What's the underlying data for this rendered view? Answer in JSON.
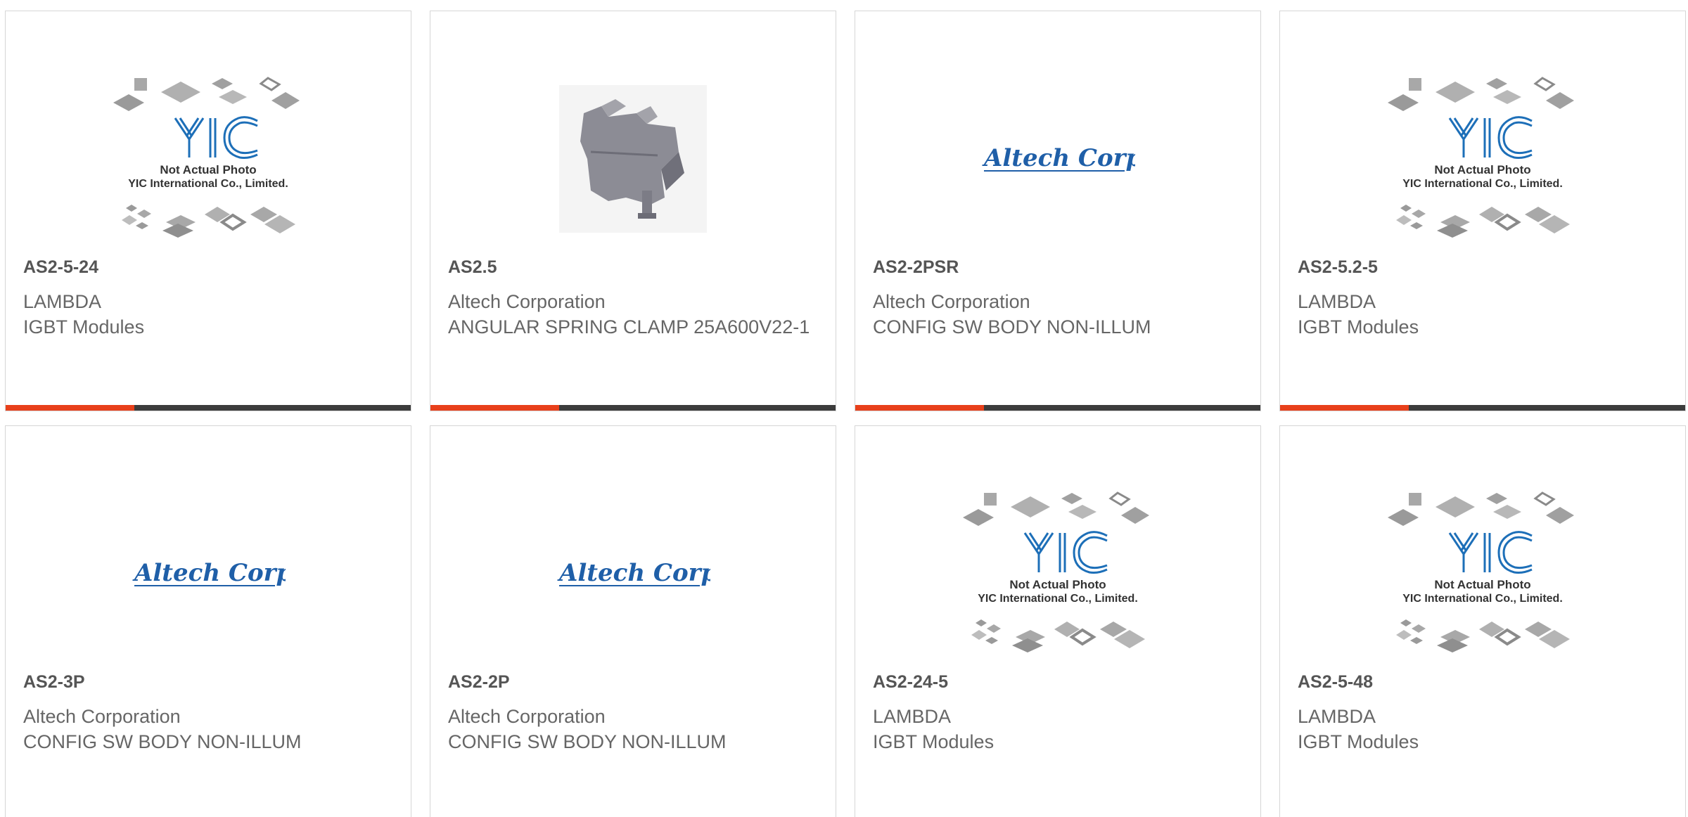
{
  "colors": {
    "accent": "#e8401b",
    "bar": "#3c3c3c",
    "altech_blue": "#1f5fa8",
    "yic_blue": "#1d6fb8"
  },
  "placeholder": {
    "yic_line1": "Not Actual Photo",
    "yic_line2": "YIC International Co., Limited.",
    "altech_logo": "Altech Corp."
  },
  "products": [
    {
      "part": "AS2-5-24",
      "maker": "LAMBDA",
      "desc": "IGBT Modules",
      "image": "yic-placeholder"
    },
    {
      "part": "AS2.5",
      "maker": "Altech Corporation",
      "desc": "ANGULAR SPRING CLAMP 25A600V22-1",
      "image": "terminal-block-photo"
    },
    {
      "part": "AS2-2PSR",
      "maker": "Altech Corporation",
      "desc": "CONFIG SW BODY NON-ILLUM",
      "image": "altech-logo"
    },
    {
      "part": "AS2-5.2-5",
      "maker": "LAMBDA",
      "desc": "IGBT Modules",
      "image": "yic-placeholder"
    },
    {
      "part": "AS2-3P",
      "maker": "Altech Corporation",
      "desc": "CONFIG SW BODY NON-ILLUM",
      "image": "altech-logo"
    },
    {
      "part": "AS2-2P",
      "maker": "Altech Corporation",
      "desc": "CONFIG SW BODY NON-ILLUM",
      "image": "altech-logo"
    },
    {
      "part": "AS2-24-5",
      "maker": "LAMBDA",
      "desc": "IGBT Modules",
      "image": "yic-placeholder"
    },
    {
      "part": "AS2-5-48",
      "maker": "LAMBDA",
      "desc": "IGBT Modules",
      "image": "yic-placeholder"
    }
  ]
}
